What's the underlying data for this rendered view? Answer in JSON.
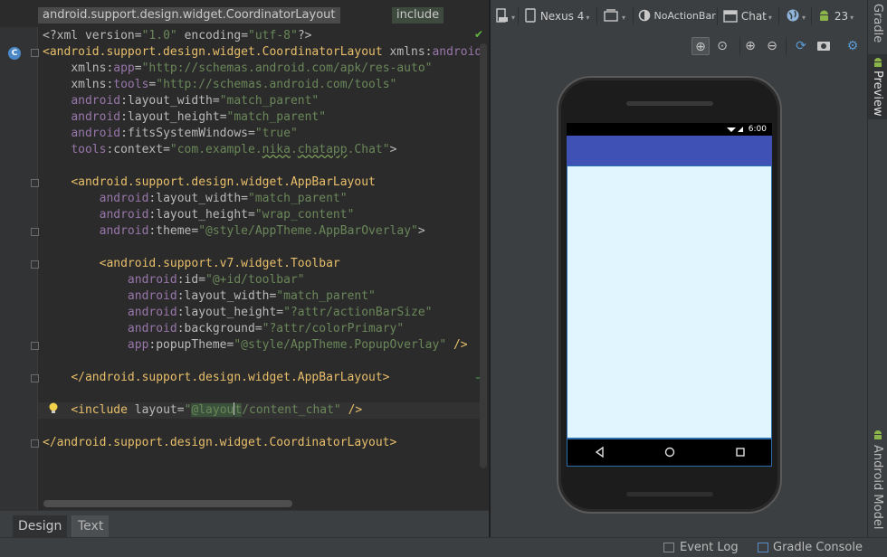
{
  "breadcrumb": {
    "path": "android.support.design.widget.CoordinatorLayout",
    "current": "include"
  },
  "code_lines": [
    [
      [
        "t",
        "<?xml "
      ],
      [
        "a",
        "version"
      ],
      [
        "t",
        "="
      ],
      [
        "v",
        "\"1.0\""
      ],
      [
        "t",
        " "
      ],
      [
        "a",
        "encoding"
      ],
      [
        "t",
        "="
      ],
      [
        "v",
        "\"utf-8\""
      ],
      [
        "t",
        "?>"
      ]
    ],
    [
      [
        "g",
        "<android.support.design.widget.CoordinatorLayout "
      ],
      [
        "a",
        "xmlns:"
      ],
      [
        "n",
        "android"
      ]
    ],
    [
      [
        "t",
        "    "
      ],
      [
        "a",
        "xmlns:"
      ],
      [
        "n",
        "app"
      ],
      [
        "t",
        "="
      ],
      [
        "v",
        "\"http://schemas.android.com/apk/res-auto\""
      ]
    ],
    [
      [
        "t",
        "    "
      ],
      [
        "a",
        "xmlns:"
      ],
      [
        "n",
        "tools"
      ],
      [
        "t",
        "="
      ],
      [
        "v",
        "\"http://schemas.android.com/tools\""
      ]
    ],
    [
      [
        "t",
        "    "
      ],
      [
        "n",
        "android"
      ],
      [
        "t",
        ":"
      ],
      [
        "a",
        "layout_width"
      ],
      [
        "t",
        "="
      ],
      [
        "v",
        "\"match_parent\""
      ]
    ],
    [
      [
        "t",
        "    "
      ],
      [
        "n",
        "android"
      ],
      [
        "t",
        ":"
      ],
      [
        "a",
        "layout_height"
      ],
      [
        "t",
        "="
      ],
      [
        "v",
        "\"match_parent\""
      ]
    ],
    [
      [
        "t",
        "    "
      ],
      [
        "n",
        "android"
      ],
      [
        "t",
        ":"
      ],
      [
        "a",
        "fitsSystemWindows"
      ],
      [
        "t",
        "="
      ],
      [
        "v",
        "\"true\""
      ]
    ],
    [
      [
        "t",
        "    "
      ],
      [
        "n",
        "tools"
      ],
      [
        "t",
        ":"
      ],
      [
        "a",
        "context"
      ],
      [
        "t",
        "="
      ],
      [
        "v",
        "\"com.example."
      ],
      [
        "vu",
        "nika"
      ],
      [
        "v",
        "."
      ],
      [
        "vu",
        "chatapp"
      ],
      [
        "v",
        ".Chat\""
      ],
      [
        "t",
        ">"
      ]
    ],
    [],
    [
      [
        "t",
        "    "
      ],
      [
        "g",
        "<android.support.design.widget.AppBarLayout"
      ]
    ],
    [
      [
        "t",
        "        "
      ],
      [
        "n",
        "android"
      ],
      [
        "t",
        ":"
      ],
      [
        "a",
        "layout_width"
      ],
      [
        "t",
        "="
      ],
      [
        "v",
        "\"match_parent\""
      ]
    ],
    [
      [
        "t",
        "        "
      ],
      [
        "n",
        "android"
      ],
      [
        "t",
        ":"
      ],
      [
        "a",
        "layout_height"
      ],
      [
        "t",
        "="
      ],
      [
        "v",
        "\"wrap_content\""
      ]
    ],
    [
      [
        "t",
        "        "
      ],
      [
        "n",
        "android"
      ],
      [
        "t",
        ":"
      ],
      [
        "a",
        "theme"
      ],
      [
        "t",
        "="
      ],
      [
        "v",
        "\"@style/AppTheme.AppBarOverlay\""
      ],
      [
        "t",
        ">"
      ]
    ],
    [],
    [
      [
        "t",
        "        "
      ],
      [
        "g",
        "<android.support.v7.widget.Toolbar"
      ]
    ],
    [
      [
        "t",
        "            "
      ],
      [
        "n",
        "android"
      ],
      [
        "t",
        ":"
      ],
      [
        "a",
        "id"
      ],
      [
        "t",
        "="
      ],
      [
        "v",
        "\"@+id/toolbar\""
      ]
    ],
    [
      [
        "t",
        "            "
      ],
      [
        "n",
        "android"
      ],
      [
        "t",
        ":"
      ],
      [
        "a",
        "layout_width"
      ],
      [
        "t",
        "="
      ],
      [
        "v",
        "\"match_parent\""
      ]
    ],
    [
      [
        "t",
        "            "
      ],
      [
        "n",
        "android"
      ],
      [
        "t",
        ":"
      ],
      [
        "a",
        "layout_height"
      ],
      [
        "t",
        "="
      ],
      [
        "v",
        "\"?attr/actionBarSize\""
      ]
    ],
    [
      [
        "t",
        "            "
      ],
      [
        "n",
        "android"
      ],
      [
        "t",
        ":"
      ],
      [
        "a",
        "background"
      ],
      [
        "t",
        "="
      ],
      [
        "v",
        "\"?attr/colorPrimary\""
      ]
    ],
    [
      [
        "t",
        "            "
      ],
      [
        "n",
        "app"
      ],
      [
        "t",
        ":"
      ],
      [
        "a",
        "popupTheme"
      ],
      [
        "t",
        "="
      ],
      [
        "v",
        "\"@style/AppTheme.PopupOverlay\""
      ],
      [
        "t",
        " "
      ],
      [
        "g",
        "/>"
      ]
    ],
    [],
    [
      [
        "t",
        "    "
      ],
      [
        "g",
        "</android.support.design.widget.AppBarLayout>"
      ]
    ],
    [],
    [
      [
        "t",
        "    "
      ],
      [
        "g",
        "<include "
      ],
      [
        "a",
        "layout"
      ],
      [
        "t",
        "="
      ],
      [
        "v",
        "\""
      ],
      [
        "h",
        "@layou"
      ],
      [
        "c",
        ""
      ],
      [
        "h",
        "t"
      ],
      [
        "v",
        "/content_chat\""
      ],
      [
        "t",
        " "
      ],
      [
        "g",
        "/>"
      ]
    ],
    [],
    [
      [
        "g",
        "</android.support.design.widget.CoordinatorLayout>"
      ]
    ]
  ],
  "editor_tabs": {
    "design": "Design",
    "text": "Text"
  },
  "toolbar": {
    "device": "Nexus 4",
    "theme": "NoActionBar",
    "activity": "Chat",
    "api": "23"
  },
  "device_screen": {
    "clock": "6:00"
  },
  "side_tabs": {
    "gradle": "Gradle",
    "preview": "Preview",
    "android_model": "Android Model"
  },
  "status_bar": {
    "event_log": "Event Log",
    "gradle_console": "Gradle Console"
  }
}
